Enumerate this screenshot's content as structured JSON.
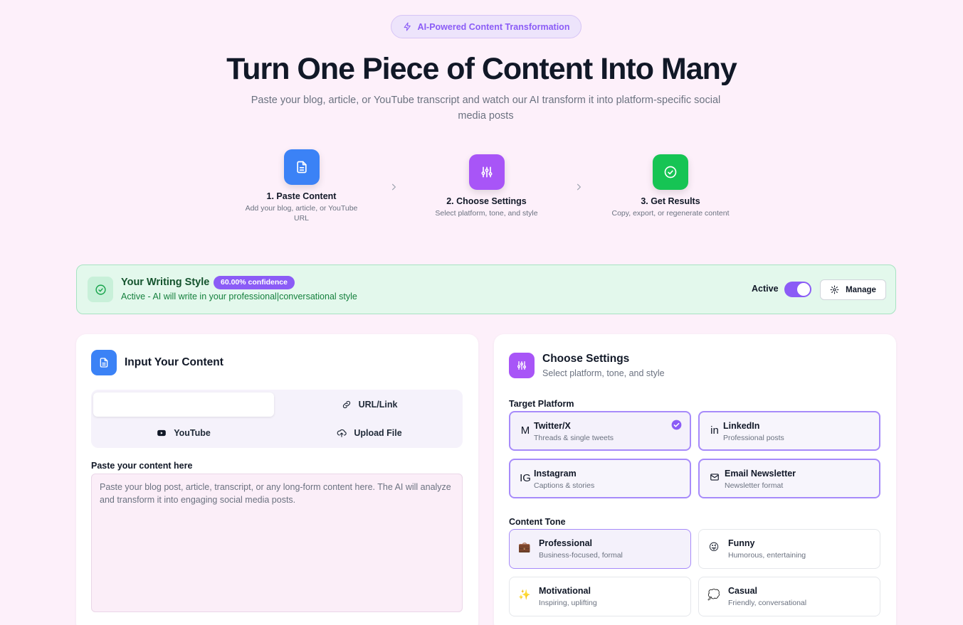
{
  "badge": {
    "label": "AI-Powered Content Transformation",
    "icon": "zap-icon"
  },
  "hero": {
    "title": "Turn One Piece of Content Into Many",
    "subtitle": "Paste your blog, article, or YouTube transcript and watch our AI transform it into platform-specific social media posts"
  },
  "steps": [
    {
      "title": "1. Paste Content",
      "desc": "Add your blog, article, or YouTube URL",
      "icon": "document-icon",
      "color": "#3b82f6"
    },
    {
      "title": "2. Choose Settings",
      "desc": "Select platform, tone, and style",
      "icon": "sliders-icon",
      "color": "#a855f7"
    },
    {
      "title": "3. Get Results",
      "desc": "Copy, export, or regenerate content",
      "icon": "check-circle-icon",
      "color": "#16c454"
    }
  ],
  "writing_style": {
    "title": "Your Writing Style",
    "confidence": "60.00% confidence",
    "description": "Active - AI will write in your professional|conversational style",
    "active_label": "Active",
    "active": true,
    "manage_label": "Manage"
  },
  "input": {
    "title": "Input Your Content",
    "tabs": [
      {
        "label": "",
        "icon": "",
        "selected": true
      },
      {
        "label": "URL/Link",
        "icon": "link-icon"
      },
      {
        "label": "YouTube",
        "icon": "youtube-icon"
      },
      {
        "label": "Upload File",
        "icon": "upload-icon"
      }
    ],
    "field_label": "Paste your content here",
    "placeholder": "Paste your blog post, article, transcript, or any long-form content here. The AI will analyze and transform it into engaging social media posts."
  },
  "settings": {
    "title": "Choose Settings",
    "subtitle": "Select platform, tone, and style",
    "platform_label": "Target Platform",
    "platforms": [
      {
        "icon": "M",
        "name": "Twitter/X",
        "desc": "Threads & single tweets",
        "selected": true
      },
      {
        "icon": "in",
        "name": "LinkedIn",
        "desc": "Professional posts"
      },
      {
        "icon": "IG",
        "name": "Instagram",
        "desc": "Captions & stories"
      },
      {
        "icon": "mail-icon",
        "name": "Email Newsletter",
        "desc": "Newsletter format"
      }
    ],
    "tone_label": "Content Tone",
    "tones": [
      {
        "icon": "💼",
        "name": "Professional",
        "desc": "Business-focused, formal",
        "selected": true
      },
      {
        "icon": "😜",
        "name": "Funny",
        "desc": "Humorous, entertaining"
      },
      {
        "icon": "✨",
        "name": "Motivational",
        "desc": "Inspiring, uplifting"
      },
      {
        "icon": "💭",
        "name": "Casual",
        "desc": "Friendly, conversational"
      }
    ]
  }
}
